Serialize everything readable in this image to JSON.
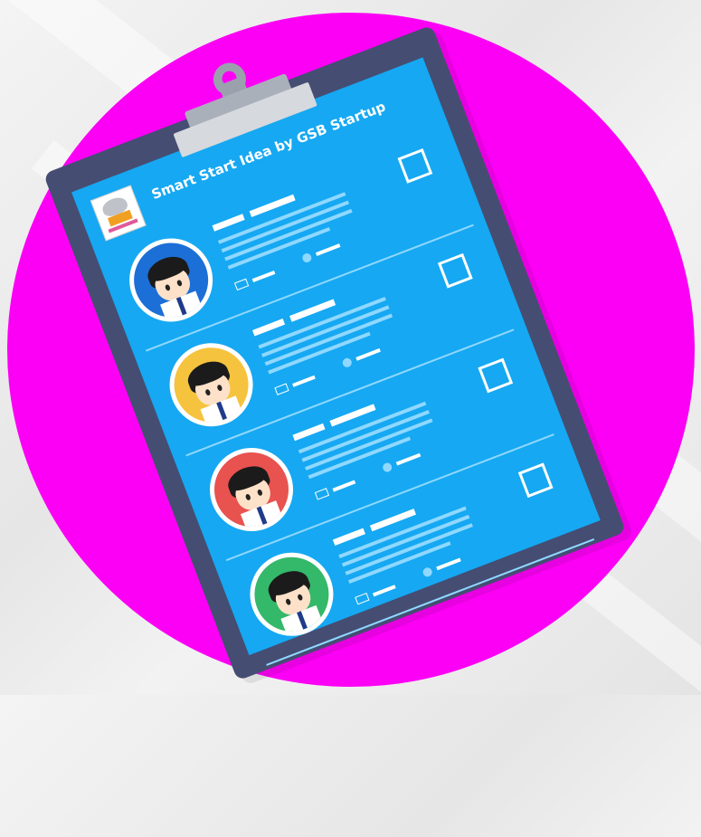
{
  "clipboard": {
    "title": "Smart Start Idea by GSB Startup",
    "entries": [
      {
        "avatar_color": "#1c6fd6",
        "checked": false
      },
      {
        "avatar_color": "#f5c33d",
        "checked": false
      },
      {
        "avatar_color": "#e8524f",
        "checked": false
      },
      {
        "avatar_color": "#34b86a",
        "checked": false
      }
    ]
  },
  "colors": {
    "circle": "#fb00f4",
    "board": "#454d73",
    "paper": "#16a8f2"
  }
}
